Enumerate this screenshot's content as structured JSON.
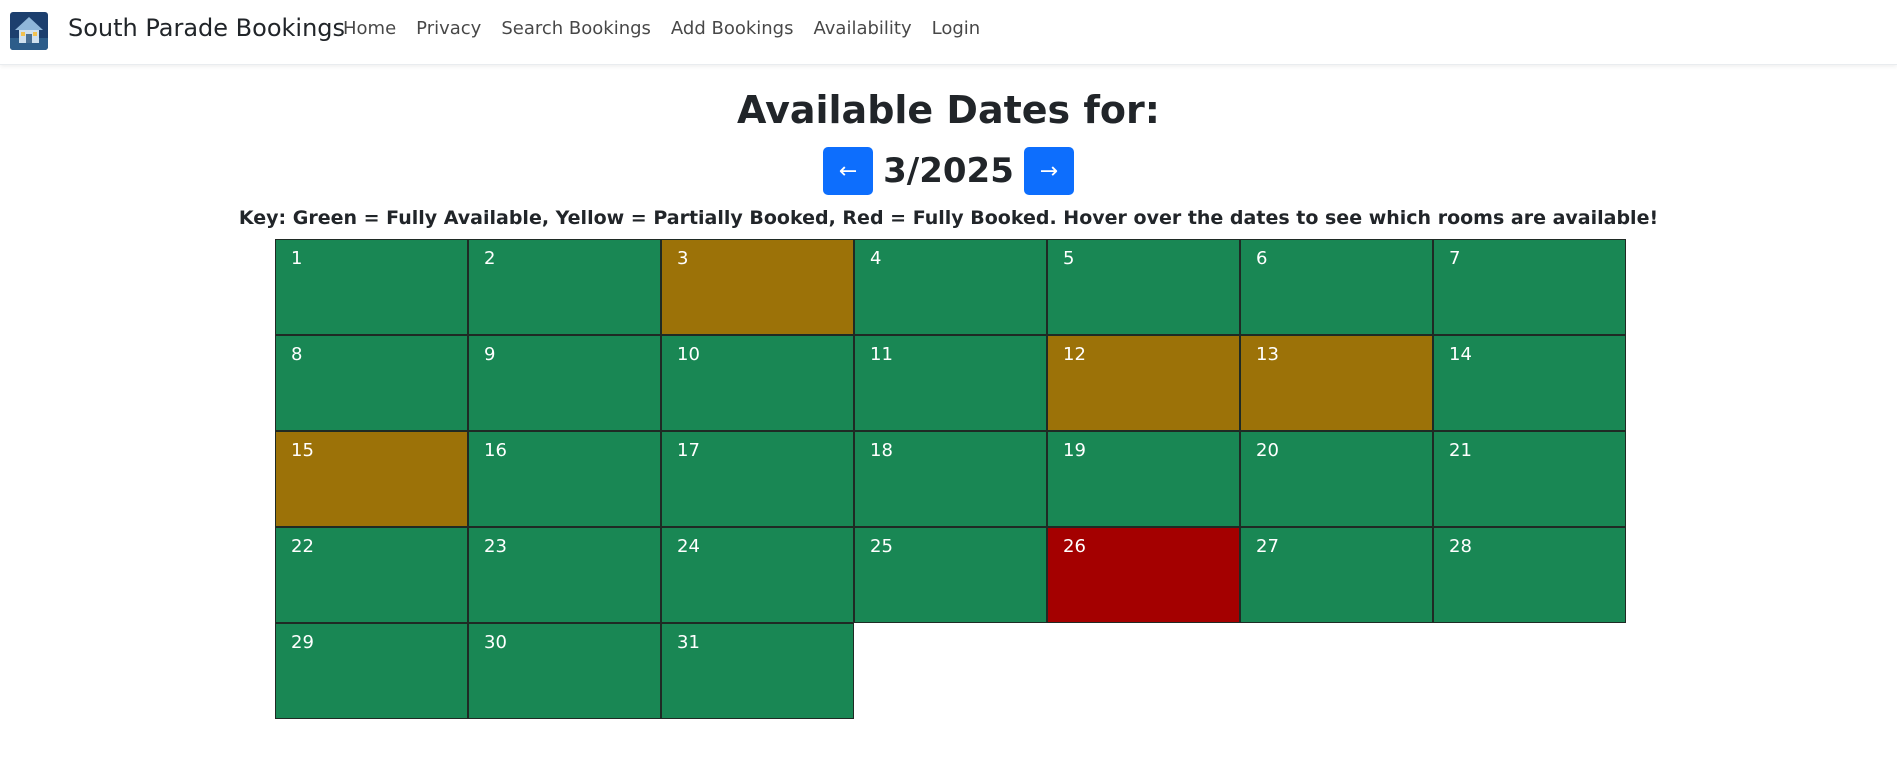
{
  "navbar": {
    "brand": "South Parade Bookings",
    "links": [
      "Home",
      "Privacy",
      "Search Bookings",
      "Add Bookings",
      "Availability",
      "Login"
    ]
  },
  "page": {
    "title": "Available Dates for:",
    "month_label": "3/2025",
    "prev_label": "←",
    "next_label": "→",
    "key_text": "Key: Green = Fully Available, Yellow = Partially Booked, Red = Fully Booked. Hover over the dates to see which rooms are available!"
  },
  "colors": {
    "fully_available": "#198754",
    "partially_booked": "#9c7208",
    "fully_booked": "#a40000",
    "primary_button": "#0d6efd"
  },
  "calendar": {
    "days": [
      {
        "day": "1",
        "status": "full"
      },
      {
        "day": "2",
        "status": "full"
      },
      {
        "day": "3",
        "status": "partial"
      },
      {
        "day": "4",
        "status": "full"
      },
      {
        "day": "5",
        "status": "full"
      },
      {
        "day": "6",
        "status": "full"
      },
      {
        "day": "7",
        "status": "full"
      },
      {
        "day": "8",
        "status": "full"
      },
      {
        "day": "9",
        "status": "full"
      },
      {
        "day": "10",
        "status": "full"
      },
      {
        "day": "11",
        "status": "full"
      },
      {
        "day": "12",
        "status": "partial"
      },
      {
        "day": "13",
        "status": "partial"
      },
      {
        "day": "14",
        "status": "full"
      },
      {
        "day": "15",
        "status": "partial"
      },
      {
        "day": "16",
        "status": "full"
      },
      {
        "day": "17",
        "status": "full"
      },
      {
        "day": "18",
        "status": "full"
      },
      {
        "day": "19",
        "status": "full"
      },
      {
        "day": "20",
        "status": "full"
      },
      {
        "day": "21",
        "status": "full"
      },
      {
        "day": "22",
        "status": "full"
      },
      {
        "day": "23",
        "status": "full"
      },
      {
        "day": "24",
        "status": "full"
      },
      {
        "day": "25",
        "status": "full"
      },
      {
        "day": "26",
        "status": "booked"
      },
      {
        "day": "27",
        "status": "full"
      },
      {
        "day": "28",
        "status": "full"
      },
      {
        "day": "29",
        "status": "full"
      },
      {
        "day": "30",
        "status": "full"
      },
      {
        "day": "31",
        "status": "full"
      }
    ]
  }
}
